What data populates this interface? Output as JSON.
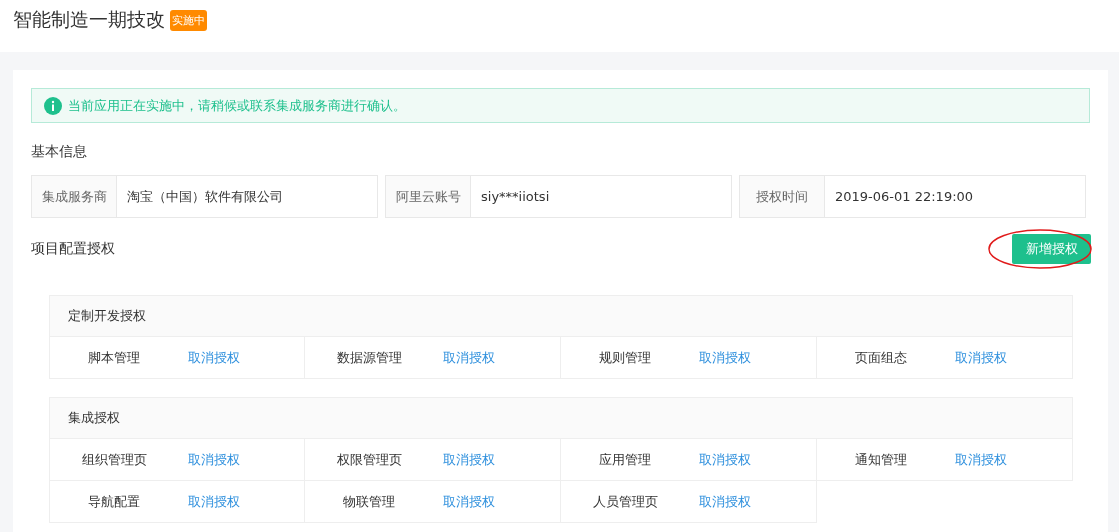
{
  "page": {
    "title": "智能制造一期技改",
    "status_badge": "实施中"
  },
  "alert": {
    "text": "当前应用正在实施中，请稍候或联系集成服务商进行确认。"
  },
  "basic_info": {
    "heading": "基本信息",
    "fields": [
      {
        "label": "集成服务商",
        "value": "淘宝（中国）软件有限公司"
      },
      {
        "label": "阿里云账号",
        "value": "siy***iiotsi"
      },
      {
        "label": "授权时间",
        "value": "2019-06-01 22:19:00"
      }
    ]
  },
  "authorization": {
    "heading": "项目配置授权",
    "add_button": {
      "label": "新增授权",
      "highlighted": true
    },
    "groups": [
      {
        "title": "定制开发授权",
        "items": [
          {
            "name": "脚本管理",
            "action": "取消授权"
          },
          {
            "name": "数据源管理",
            "action": "取消授权"
          },
          {
            "name": "规则管理",
            "action": "取消授权"
          },
          {
            "name": "页面组态",
            "action": "取消授权"
          }
        ]
      },
      {
        "title": "集成授权",
        "items": [
          {
            "name": "组织管理页",
            "action": "取消授权"
          },
          {
            "name": "权限管理页",
            "action": "取消授权"
          },
          {
            "name": "应用管理",
            "action": "取消授权"
          },
          {
            "name": "通知管理",
            "action": "取消授权"
          },
          {
            "name": "导航配置",
            "action": "取消授权"
          },
          {
            "name": "物联管理",
            "action": "取消授权"
          },
          {
            "name": "人员管理页",
            "action": "取消授权"
          }
        ]
      }
    ]
  }
}
